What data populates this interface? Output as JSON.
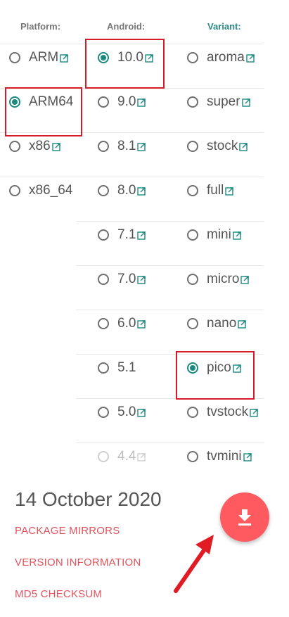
{
  "headers": {
    "platform": "Platform:",
    "android": "Android:",
    "variant": "Variant:"
  },
  "platforms": [
    {
      "label": "ARM",
      "selected": false,
      "external": true
    },
    {
      "label": "ARM64",
      "selected": true,
      "external": false
    },
    {
      "label": "x86",
      "selected": false,
      "external": true
    },
    {
      "label": "x86_64",
      "selected": false,
      "external": false
    }
  ],
  "android_versions": [
    {
      "label": "10.0",
      "selected": true,
      "external": true,
      "disabled": false
    },
    {
      "label": "9.0",
      "selected": false,
      "external": true,
      "disabled": false
    },
    {
      "label": "8.1",
      "selected": false,
      "external": true,
      "disabled": false
    },
    {
      "label": "8.0",
      "selected": false,
      "external": true,
      "disabled": false
    },
    {
      "label": "7.1",
      "selected": false,
      "external": true,
      "disabled": false
    },
    {
      "label": "7.0",
      "selected": false,
      "external": true,
      "disabled": false
    },
    {
      "label": "6.0",
      "selected": false,
      "external": true,
      "disabled": false
    },
    {
      "label": "5.1",
      "selected": false,
      "external": false,
      "disabled": false
    },
    {
      "label": "5.0",
      "selected": false,
      "external": true,
      "disabled": false
    },
    {
      "label": "4.4",
      "selected": false,
      "external": true,
      "disabled": true
    }
  ],
  "variants": [
    {
      "label": "aroma",
      "selected": false,
      "external": true
    },
    {
      "label": "super",
      "selected": false,
      "external": true
    },
    {
      "label": "stock",
      "selected": false,
      "external": true
    },
    {
      "label": "full",
      "selected": false,
      "external": true
    },
    {
      "label": "mini",
      "selected": false,
      "external": true
    },
    {
      "label": "micro",
      "selected": false,
      "external": true
    },
    {
      "label": "nano",
      "selected": false,
      "external": true
    },
    {
      "label": "pico",
      "selected": true,
      "external": true
    },
    {
      "label": "tvstock",
      "selected": false,
      "external": true
    },
    {
      "label": "tvmini",
      "selected": false,
      "external": true
    }
  ],
  "release": {
    "date": "14 October 2020",
    "links": [
      "PACKAGE MIRRORS",
      "VERSION INFORMATION",
      "MD5 CHECKSUM"
    ]
  },
  "download_button": {
    "icon": "download-icon"
  },
  "colors": {
    "accent_teal": "#1b8a80",
    "link_red": "#e2525c",
    "fab": "#ff5a5f",
    "highlight_red": "#d81b2a"
  }
}
